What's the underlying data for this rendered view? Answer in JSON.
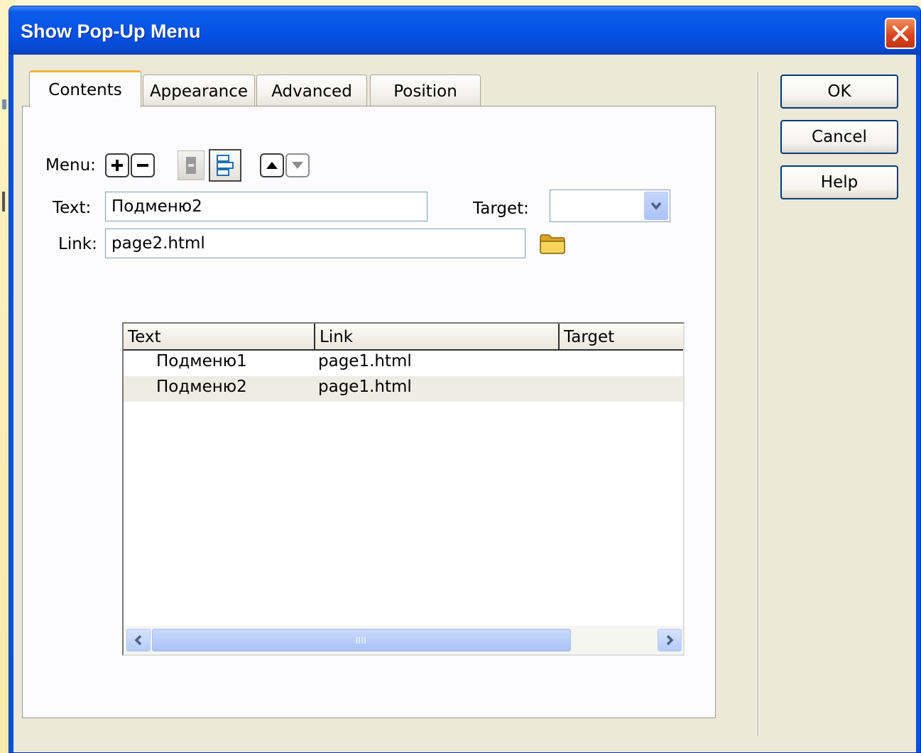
{
  "window": {
    "title": "Show Pop-Up Menu"
  },
  "tabs": [
    {
      "label": "Contents",
      "active": true
    },
    {
      "label": "Appearance",
      "active": false
    },
    {
      "label": "Advanced",
      "active": false
    },
    {
      "label": "Position",
      "active": false
    }
  ],
  "buttons": {
    "ok": "OK",
    "cancel": "Cancel",
    "help": "Help"
  },
  "form": {
    "menu_label": "Menu:",
    "text_label": "Text:",
    "text_value": "Подменю2",
    "target_label": "Target:",
    "target_value": "",
    "link_label": "Link:",
    "link_value": "page2.html"
  },
  "grid": {
    "columns": [
      "Text",
      "Link",
      "Target"
    ],
    "rows": [
      {
        "text": "Подменю1",
        "link": "page1.html",
        "target": "",
        "selected": false
      },
      {
        "text": "Подменю2",
        "link": "page1.html",
        "target": "",
        "selected": true
      }
    ]
  },
  "icons": {
    "add": "plus-icon",
    "remove": "minus-icon",
    "outdent": "outdent-icon",
    "indent": "indent-icon",
    "move_up": "arrow-up-icon",
    "move_down": "arrow-down-icon",
    "browse": "folder-icon",
    "close": "close-icon"
  },
  "colors": {
    "titlebar": "#0654e6",
    "client_bg": "#ece9d8",
    "tab_highlight": "#f4b33a"
  }
}
